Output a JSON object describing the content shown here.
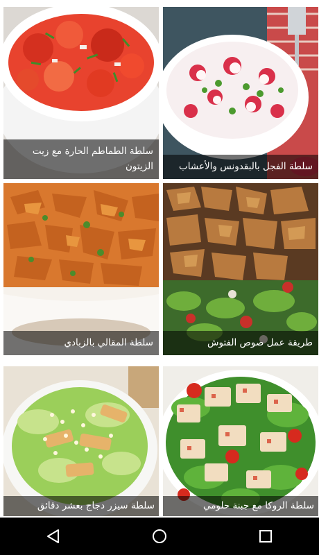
{
  "recipes": [
    {
      "title": "سلطة الطماطم الحارة مع زيت الزيتون"
    },
    {
      "title": "سلطة الفجل بالبقدونس والأعشاب"
    },
    {
      "title": "سلطة المقالي بالزبادي"
    },
    {
      "title": "طريقة عمل صوص الفتوش"
    },
    {
      "title": "سلطة سيزر دجاج بعشر دقائق"
    },
    {
      "title": "سلطة الروكا مع جبنة حلومي"
    }
  ],
  "navbar": {
    "back_icon": "back-icon",
    "home_icon": "home-icon",
    "recents_icon": "recents-icon"
  },
  "colors": {
    "caption_overlay": "#000000",
    "caption_text": "#ffffff",
    "navbar_bg": "#000000"
  }
}
